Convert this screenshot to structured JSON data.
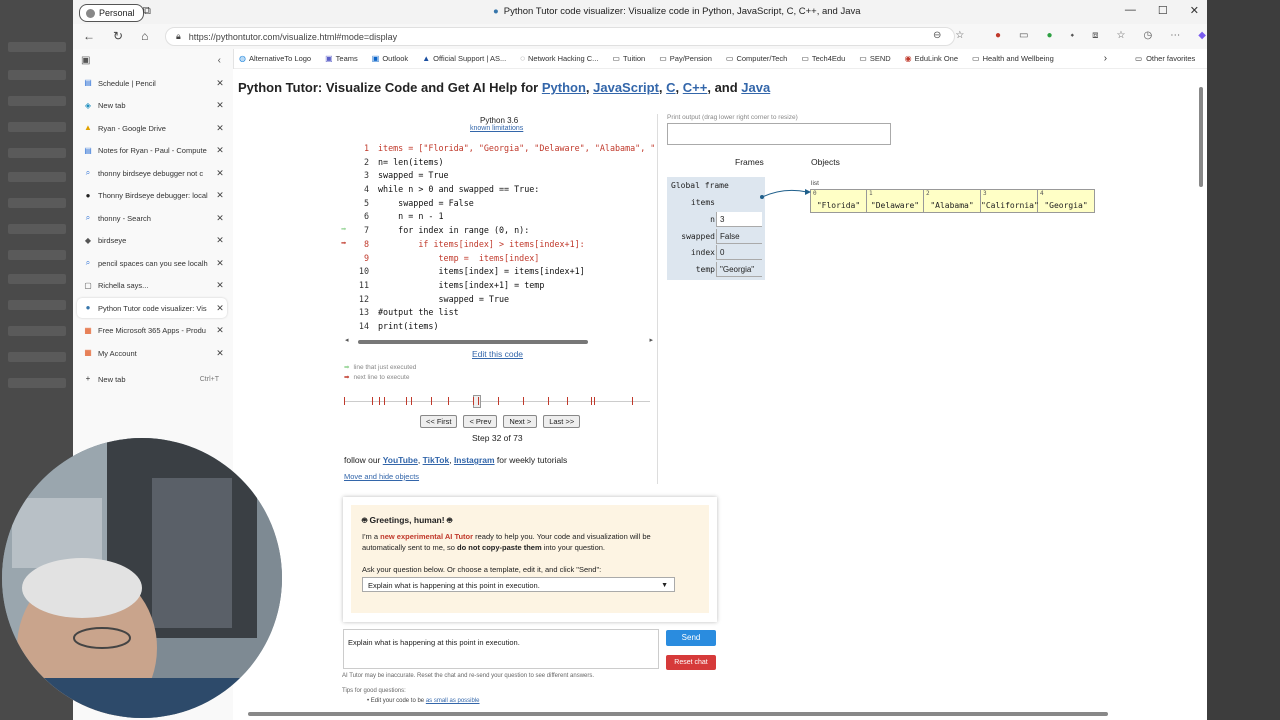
{
  "browser": {
    "profile_label": "Personal",
    "window_title": "Python Tutor code visualizer: Visualize code in Python, JavaScript, C, C++, and Java",
    "url": "https://pythontutor.com/visualize.html#mode=display",
    "favorites": [
      {
        "label": "AlternativeTo Logo",
        "icon": "link-icon"
      },
      {
        "label": "Teams",
        "icon": "teams-icon"
      },
      {
        "label": "Outlook",
        "icon": "outlook-icon"
      },
      {
        "label": "Official Support | AS...",
        "icon": "asus-icon"
      },
      {
        "label": "Network Hacking C...",
        "icon": "globe-icon"
      },
      {
        "label": "Tuition",
        "icon": "folder-icon"
      },
      {
        "label": "Pay/Pension",
        "icon": "folder-icon"
      },
      {
        "label": "Computer/Tech",
        "icon": "folder-icon"
      },
      {
        "label": "Tech4Edu",
        "icon": "folder-icon"
      },
      {
        "label": "SEND",
        "icon": "folder-icon"
      },
      {
        "label": "EduLink One",
        "icon": "edulink-icon"
      },
      {
        "label": "Health and Wellbeing",
        "icon": "folder-icon"
      }
    ],
    "other_favorites": "Other favorites",
    "tabs": [
      {
        "label": "Schedule | Pencil",
        "icon": "pencil-app-icon",
        "active": false
      },
      {
        "label": "New tab",
        "icon": "edge-icon",
        "active": false
      },
      {
        "label": "Ryan - Google Drive",
        "icon": "google-drive-icon",
        "active": false
      },
      {
        "label": "Notes for Ryan - Paul - Compute",
        "icon": "google-docs-icon",
        "active": false
      },
      {
        "label": "thonny birdseye debugger not c",
        "icon": "search-icon",
        "active": false
      },
      {
        "label": "Thonny Birdseye debugger: local",
        "icon": "github-icon",
        "active": false
      },
      {
        "label": "thonny - Search",
        "icon": "search-icon",
        "active": false
      },
      {
        "label": "birdseye",
        "icon": "birdseye-icon",
        "active": false
      },
      {
        "label": "pencil spaces can you see localh",
        "icon": "search-icon",
        "active": false
      },
      {
        "label": "Richella says...",
        "icon": "app-icon",
        "active": false
      },
      {
        "label": "Python Tutor code visualizer: Vis",
        "icon": "python-icon",
        "active": true
      },
      {
        "label": "Free Microsoft 365 Apps - Produ",
        "icon": "microsoft-icon",
        "active": false
      },
      {
        "label": "My Account",
        "icon": "microsoft-icon",
        "active": false
      }
    ],
    "new_tab_label": "New tab",
    "new_tab_shortcut": "Ctrl+T"
  },
  "page": {
    "heading_prefix": "Python Tutor: Visualize Code and Get AI Help for ",
    "heading_langs": [
      "Python",
      "JavaScript",
      "C",
      "C++",
      "Java"
    ],
    "heading_sep1": ", ",
    "heading_sep_and": ", and ",
    "python_version": "Python 3.6",
    "known_limitations": "known limitations",
    "code_lines": [
      {
        "n": "1",
        "text": "items = [\"Florida\", \"Georgia\", \"Delaware\", \"Alabama\", \""
      },
      {
        "n": "2",
        "text": "n= len(items)"
      },
      {
        "n": "3",
        "text": "swapped = True"
      },
      {
        "n": "4",
        "text": "while n > 0 and swapped == True:"
      },
      {
        "n": "5",
        "text": "    swapped = False"
      },
      {
        "n": "6",
        "text": "    n = n - 1"
      },
      {
        "n": "7",
        "text": "    for index in range (0, n):"
      },
      {
        "n": "8",
        "text": "        if items[index] > items[index+1]:"
      },
      {
        "n": "9",
        "text": "            temp =  items[index]"
      },
      {
        "n": "10",
        "text": "            items[index] = items[index+1]"
      },
      {
        "n": "11",
        "text": "            items[index+1] = temp"
      },
      {
        "n": "12",
        "text": "            swapped = True"
      },
      {
        "n": "13",
        "text": "#output the list"
      },
      {
        "n": "14",
        "text": "print(items)"
      }
    ],
    "prev_line": 7,
    "current_line": 8,
    "highlight_lines": [
      1,
      8,
      9
    ],
    "edit_code": "Edit this code",
    "legend_prev": "line that just executed",
    "legend_next": "next line to execute",
    "btn_first": "<< First",
    "btn_prev": "< Prev",
    "btn_next": "Next >",
    "btn_last": "Last >>",
    "step_text": "Step 32 of 73",
    "step_current": 32,
    "step_total": 73,
    "follow_prefix": "follow our ",
    "follow_links": [
      "YouTube",
      "TikTok",
      "Instagram"
    ],
    "follow_suffix": " for weekly tutorials",
    "move_hide": "Move and hide objects",
    "print_output_label": "Print output (drag lower right corner to resize)",
    "frames_title": "Frames",
    "objects_title": "Objects",
    "global_frame": "Global frame",
    "frame_vars": [
      {
        "name": "items",
        "value": ""
      },
      {
        "name": "n",
        "value": "3"
      },
      {
        "name": "swapped",
        "value": "False"
      },
      {
        "name": "index",
        "value": "0"
      },
      {
        "name": "temp",
        "value": "\"Georgia\""
      }
    ],
    "list_label": "list",
    "list_items": [
      {
        "idx": "0",
        "value": "\"Florida\""
      },
      {
        "idx": "1",
        "value": "\"Delaware\""
      },
      {
        "idx": "2",
        "value": "\"Alabama\""
      },
      {
        "idx": "3",
        "value": "\"California\""
      },
      {
        "idx": "4",
        "value": "\"Georgia\""
      }
    ]
  },
  "ai": {
    "greeting": "Greetings, human!",
    "intro_1": "I'm a ",
    "intro_red": "new experimental AI Tutor",
    "intro_2": " ready to help you. Your code and visualization will be automatically sent to me, so ",
    "intro_bold": "do not copy-paste them",
    "intro_3": " into your question.",
    "ask_label": "Ask your question below. Or choose a template, edit it, and click \"Send\":",
    "template_selected": "Explain what is happening at this point in execution.",
    "chat_text": "Explain what is happening at this point in execution.",
    "send": "Send",
    "reset": "Reset chat",
    "disclaimer": "AI Tutor may be inaccurate. Reset the chat and re-send your question to see different answers.",
    "tips_title": "Tips for good questions:",
    "tip1_prefix": "Edit your code to be ",
    "tip1_link": "as small as possible"
  },
  "colors": {
    "link": "#3366aa",
    "current_line": "#c0392b",
    "prev_arrow": "#8fd18f",
    "frame_bg": "#dde6ef",
    "list_bg": "#ffffc6",
    "send_btn": "#2a8cdf",
    "reset_btn": "#d63a3a"
  }
}
